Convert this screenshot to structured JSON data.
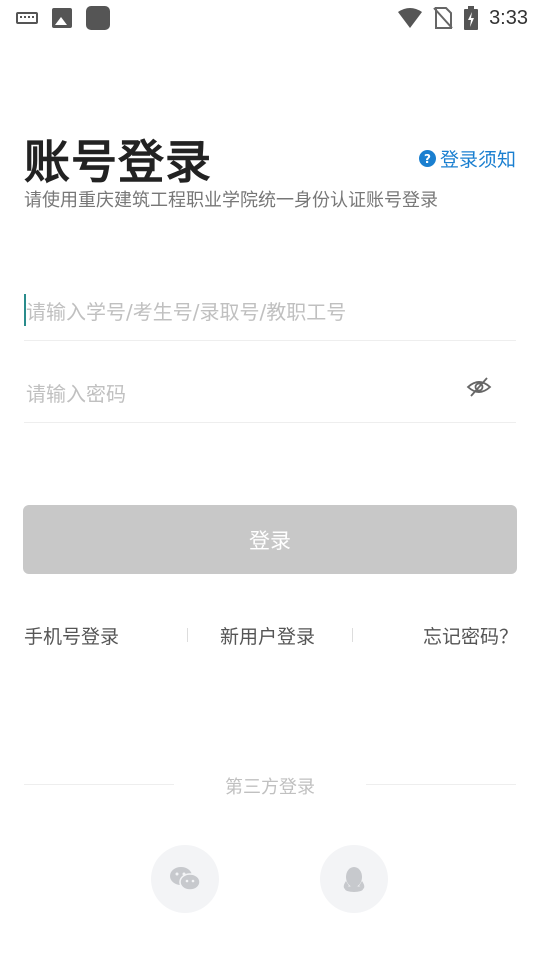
{
  "status_bar": {
    "time": "3:33",
    "icons": [
      "keyboard-icon",
      "image-icon",
      "app-square-icon",
      "wifi-icon",
      "no-sim-icon",
      "battery-charging-icon"
    ]
  },
  "header": {
    "title": "账号登录",
    "notice_link": "登录须知",
    "subtitle": "请使用重庆建筑工程职业学院统一身份认证账号登录"
  },
  "form": {
    "account_placeholder": "请输入学号/考生号/录取号/教职工号",
    "account_value": "",
    "password_placeholder": "请输入密码",
    "password_value": "",
    "login_label": "登录"
  },
  "links": {
    "phone_login": "手机号登录",
    "new_user_login": "新用户登录",
    "forgot_password": "忘记密码？"
  },
  "third_party": {
    "label": "第三方登录",
    "providers": [
      "wechat-icon",
      "qq-icon"
    ]
  },
  "colors": {
    "accent": "#1a7fd0",
    "button_disabled": "#c8c8c8",
    "caret": "#2a8c8c"
  }
}
